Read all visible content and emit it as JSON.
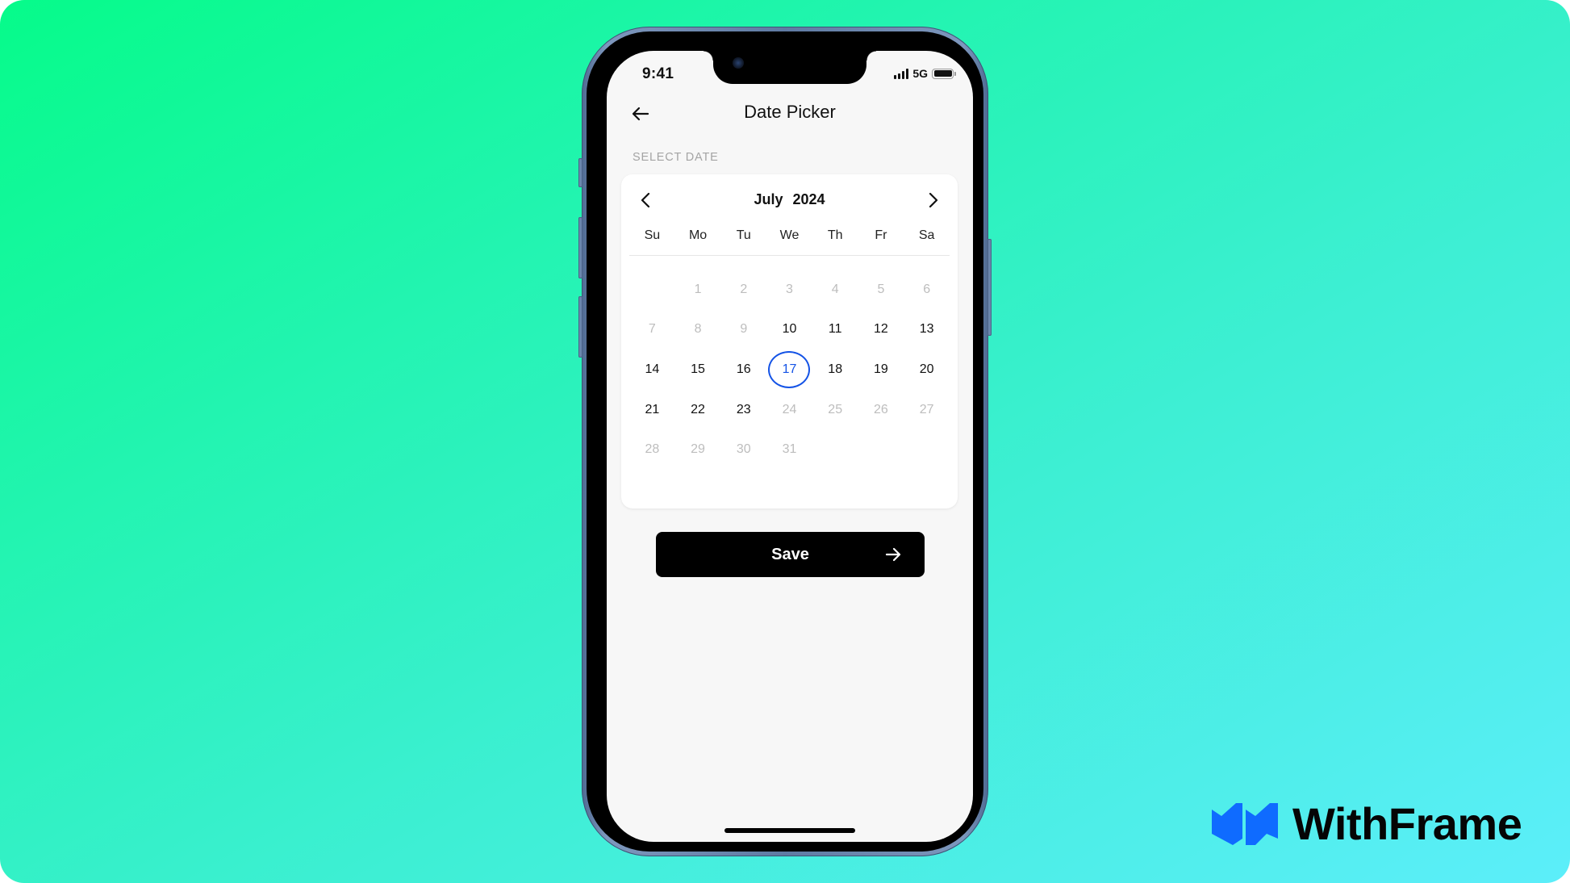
{
  "brand": {
    "name": "WithFrame",
    "mark_icon": "withframe-logo-icon",
    "mark_color": "#0f6bff"
  },
  "status_bar": {
    "time": "9:41",
    "network": "5G",
    "signal_icon": "signal-bars-icon",
    "battery_icon": "battery-icon"
  },
  "header": {
    "back_icon": "arrow-left-icon",
    "title": "Date Picker"
  },
  "section_label": "SELECT DATE",
  "calendar": {
    "month": "July",
    "year": "2024",
    "prev_icon": "chevron-left-icon",
    "next_icon": "chevron-right-icon",
    "weekdays": [
      "Su",
      "Mo",
      "Tu",
      "We",
      "Th",
      "Fr",
      "Sa"
    ],
    "selected_day": "17",
    "selected_color": "#1453e6",
    "weeks": [
      [
        {
          "d": "",
          "state": "empty"
        },
        {
          "d": "1",
          "state": "disabled"
        },
        {
          "d": "2",
          "state": "disabled"
        },
        {
          "d": "3",
          "state": "disabled"
        },
        {
          "d": "4",
          "state": "disabled"
        },
        {
          "d": "5",
          "state": "disabled"
        },
        {
          "d": "6",
          "state": "disabled"
        }
      ],
      [
        {
          "d": "7",
          "state": "disabled"
        },
        {
          "d": "8",
          "state": "disabled"
        },
        {
          "d": "9",
          "state": "disabled"
        },
        {
          "d": "10",
          "state": "enabled"
        },
        {
          "d": "11",
          "state": "enabled"
        },
        {
          "d": "12",
          "state": "enabled"
        },
        {
          "d": "13",
          "state": "enabled"
        }
      ],
      [
        {
          "d": "14",
          "state": "enabled"
        },
        {
          "d": "15",
          "state": "enabled"
        },
        {
          "d": "16",
          "state": "enabled"
        },
        {
          "d": "17",
          "state": "selected"
        },
        {
          "d": "18",
          "state": "enabled"
        },
        {
          "d": "19",
          "state": "enabled"
        },
        {
          "d": "20",
          "state": "enabled"
        }
      ],
      [
        {
          "d": "21",
          "state": "enabled"
        },
        {
          "d": "22",
          "state": "enabled"
        },
        {
          "d": "23",
          "state": "enabled"
        },
        {
          "d": "24",
          "state": "disabled"
        },
        {
          "d": "25",
          "state": "disabled"
        },
        {
          "d": "26",
          "state": "disabled"
        },
        {
          "d": "27",
          "state": "disabled"
        }
      ],
      [
        {
          "d": "28",
          "state": "disabled"
        },
        {
          "d": "29",
          "state": "disabled"
        },
        {
          "d": "30",
          "state": "disabled"
        },
        {
          "d": "31",
          "state": "disabled"
        },
        {
          "d": "",
          "state": "empty"
        },
        {
          "d": "",
          "state": "empty"
        },
        {
          "d": "",
          "state": "empty"
        }
      ]
    ]
  },
  "save_button": {
    "label": "Save",
    "icon": "arrow-right-icon"
  }
}
